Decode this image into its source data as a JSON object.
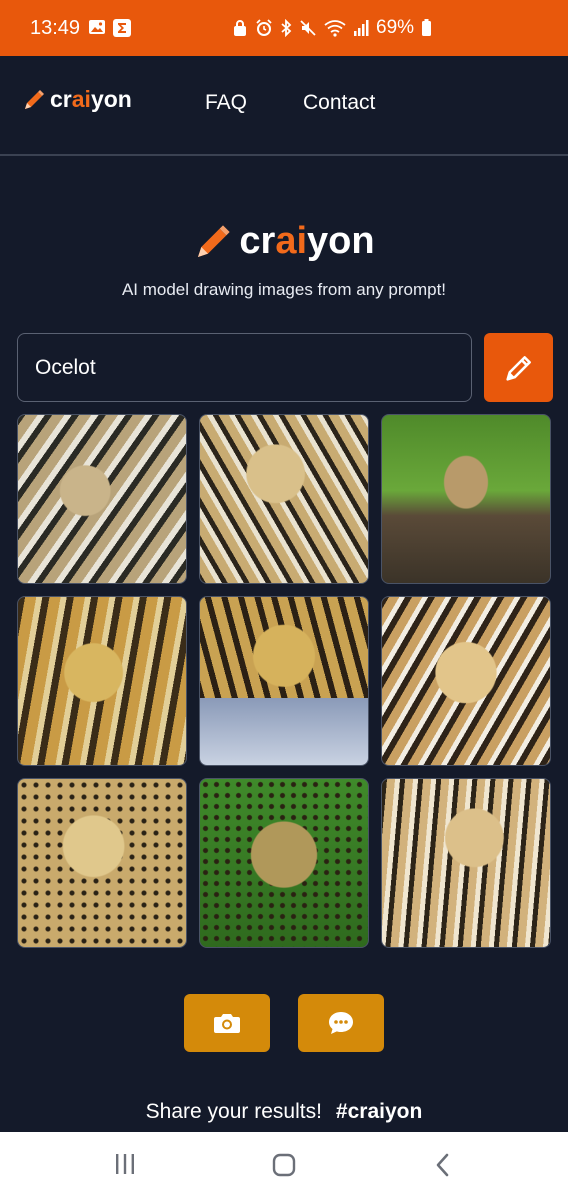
{
  "status_bar": {
    "time": "13:49",
    "battery": "69%",
    "bg_color": "#e8580c"
  },
  "nav": {
    "logo_pre": "cr",
    "logo_ai": "ai",
    "logo_post": "yon",
    "links": [
      "FAQ",
      "Contact"
    ]
  },
  "hero": {
    "logo_pre": "cr",
    "logo_ai": "ai",
    "logo_post": "yon",
    "tagline": "AI model drawing images from any prompt!"
  },
  "prompt": {
    "value": "Ocelot"
  },
  "grid": {
    "images": [
      "ocelot-image-1",
      "ocelot-image-2",
      "ocelot-image-3",
      "ocelot-image-4",
      "ocelot-image-5",
      "ocelot-image-6",
      "ocelot-image-7",
      "ocelot-image-8",
      "ocelot-image-9"
    ]
  },
  "actions": {
    "icons": [
      "camera-icon",
      "chat-bubble-icon"
    ]
  },
  "share": {
    "text": "Share your results!",
    "hashtag": "#craiyon"
  },
  "system_nav": {
    "icons": [
      "recent-apps-icon",
      "home-icon",
      "back-icon"
    ]
  },
  "colors": {
    "accent": "#e8580c",
    "background": "#141a2a",
    "action_button": "#d48a0a"
  }
}
